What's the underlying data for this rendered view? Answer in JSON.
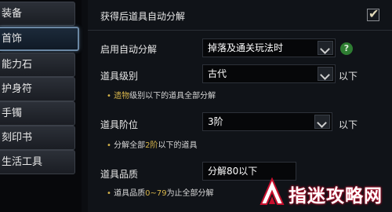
{
  "sidebar": {
    "tabs": [
      {
        "label": "装备"
      },
      {
        "label": "首饰"
      },
      {
        "label": "能力石"
      },
      {
        "label": "护身符"
      },
      {
        "label": "手镯"
      },
      {
        "label": "刻印书"
      },
      {
        "label": "生活工具"
      }
    ],
    "active_index": 1
  },
  "settings": {
    "auto_dismantle_label": "获得后道具自动分解",
    "auto_dismantle_checked": true,
    "enable_label": "启用自动分解",
    "enable_value": "掉落及通关玩法时",
    "level_label": "道具级别",
    "level_value": "古代",
    "level_suffix": "以下",
    "level_note_hl": "遗物",
    "level_note_rest": "级别以下的道具全部分解",
    "tier_label": "道具阶位",
    "tier_value": "3阶",
    "tier_suffix": "以下",
    "tier_note_pre": "分解全部",
    "tier_note_hl": "2阶",
    "tier_note_post": "以下的道具",
    "quality_label": "道具品质",
    "quality_value": "分解80以下",
    "quality_note_pre": "道具品质",
    "quality_note_hl": "0~79",
    "quality_note_post": "为止全部分解"
  },
  "watermark": {
    "text": "指迷攻略网"
  },
  "colors": {
    "accent": "#d6b44a",
    "help": "#2e7d32",
    "watermark": "#c8102e"
  }
}
